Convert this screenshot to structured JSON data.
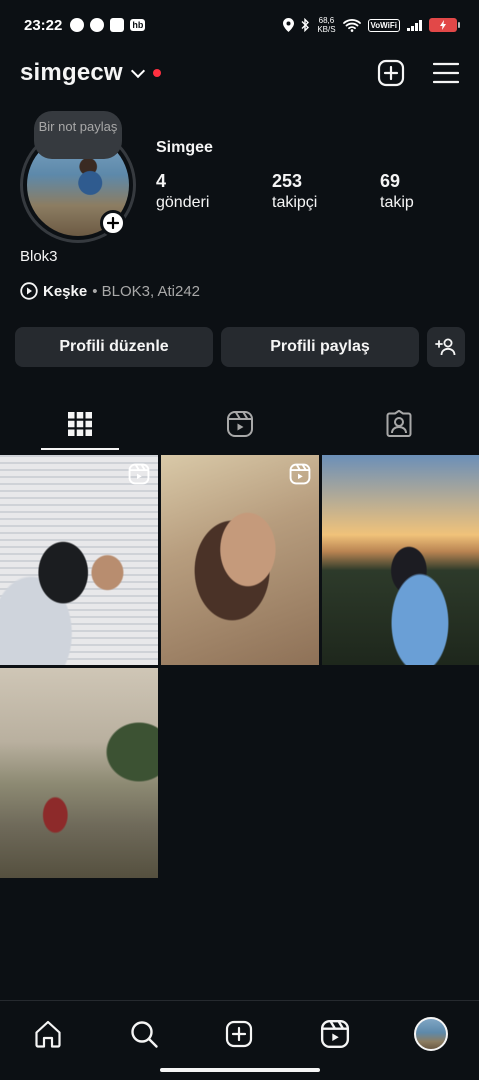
{
  "status_bar": {
    "time": "23:22",
    "net_speed_value": "68,6",
    "net_speed_unit": "KB/S",
    "vowifi": "VoWiFi",
    "hb_badge": "hb"
  },
  "header": {
    "username": "simgecw",
    "notification_dot_color": "#ff3040"
  },
  "profile": {
    "note_text": "Bir not paylaş",
    "display_name": "Simgee",
    "bio": "Blok3",
    "music": {
      "title": "Keşke",
      "artists": "• BLOK3, Ati242"
    },
    "stats": [
      {
        "value": "4",
        "label": "gönderi"
      },
      {
        "value": "253",
        "label": "takipçi"
      },
      {
        "value": "69",
        "label": "takip"
      }
    ]
  },
  "buttons": {
    "edit_profile": "Profili düzenle",
    "share_profile": "Profili paylaş"
  },
  "tabs": [
    {
      "name": "grid",
      "icon": "grid-icon",
      "active": true
    },
    {
      "name": "reels",
      "icon": "reels-icon",
      "active": false
    },
    {
      "name": "tagged",
      "icon": "tagged-icon",
      "active": false
    }
  ],
  "posts": [
    {
      "type": "reel"
    },
    {
      "type": "reel"
    },
    {
      "type": "photo"
    },
    {
      "type": "photo"
    }
  ],
  "bottom_nav": [
    "home-icon",
    "search-icon",
    "create-icon",
    "reels-icon",
    "profile-avatar"
  ],
  "colors": {
    "background": "#0c1014",
    "button_bg": "#262a2f",
    "text": "#f5f5f5",
    "muted": "#a8a8a8"
  }
}
